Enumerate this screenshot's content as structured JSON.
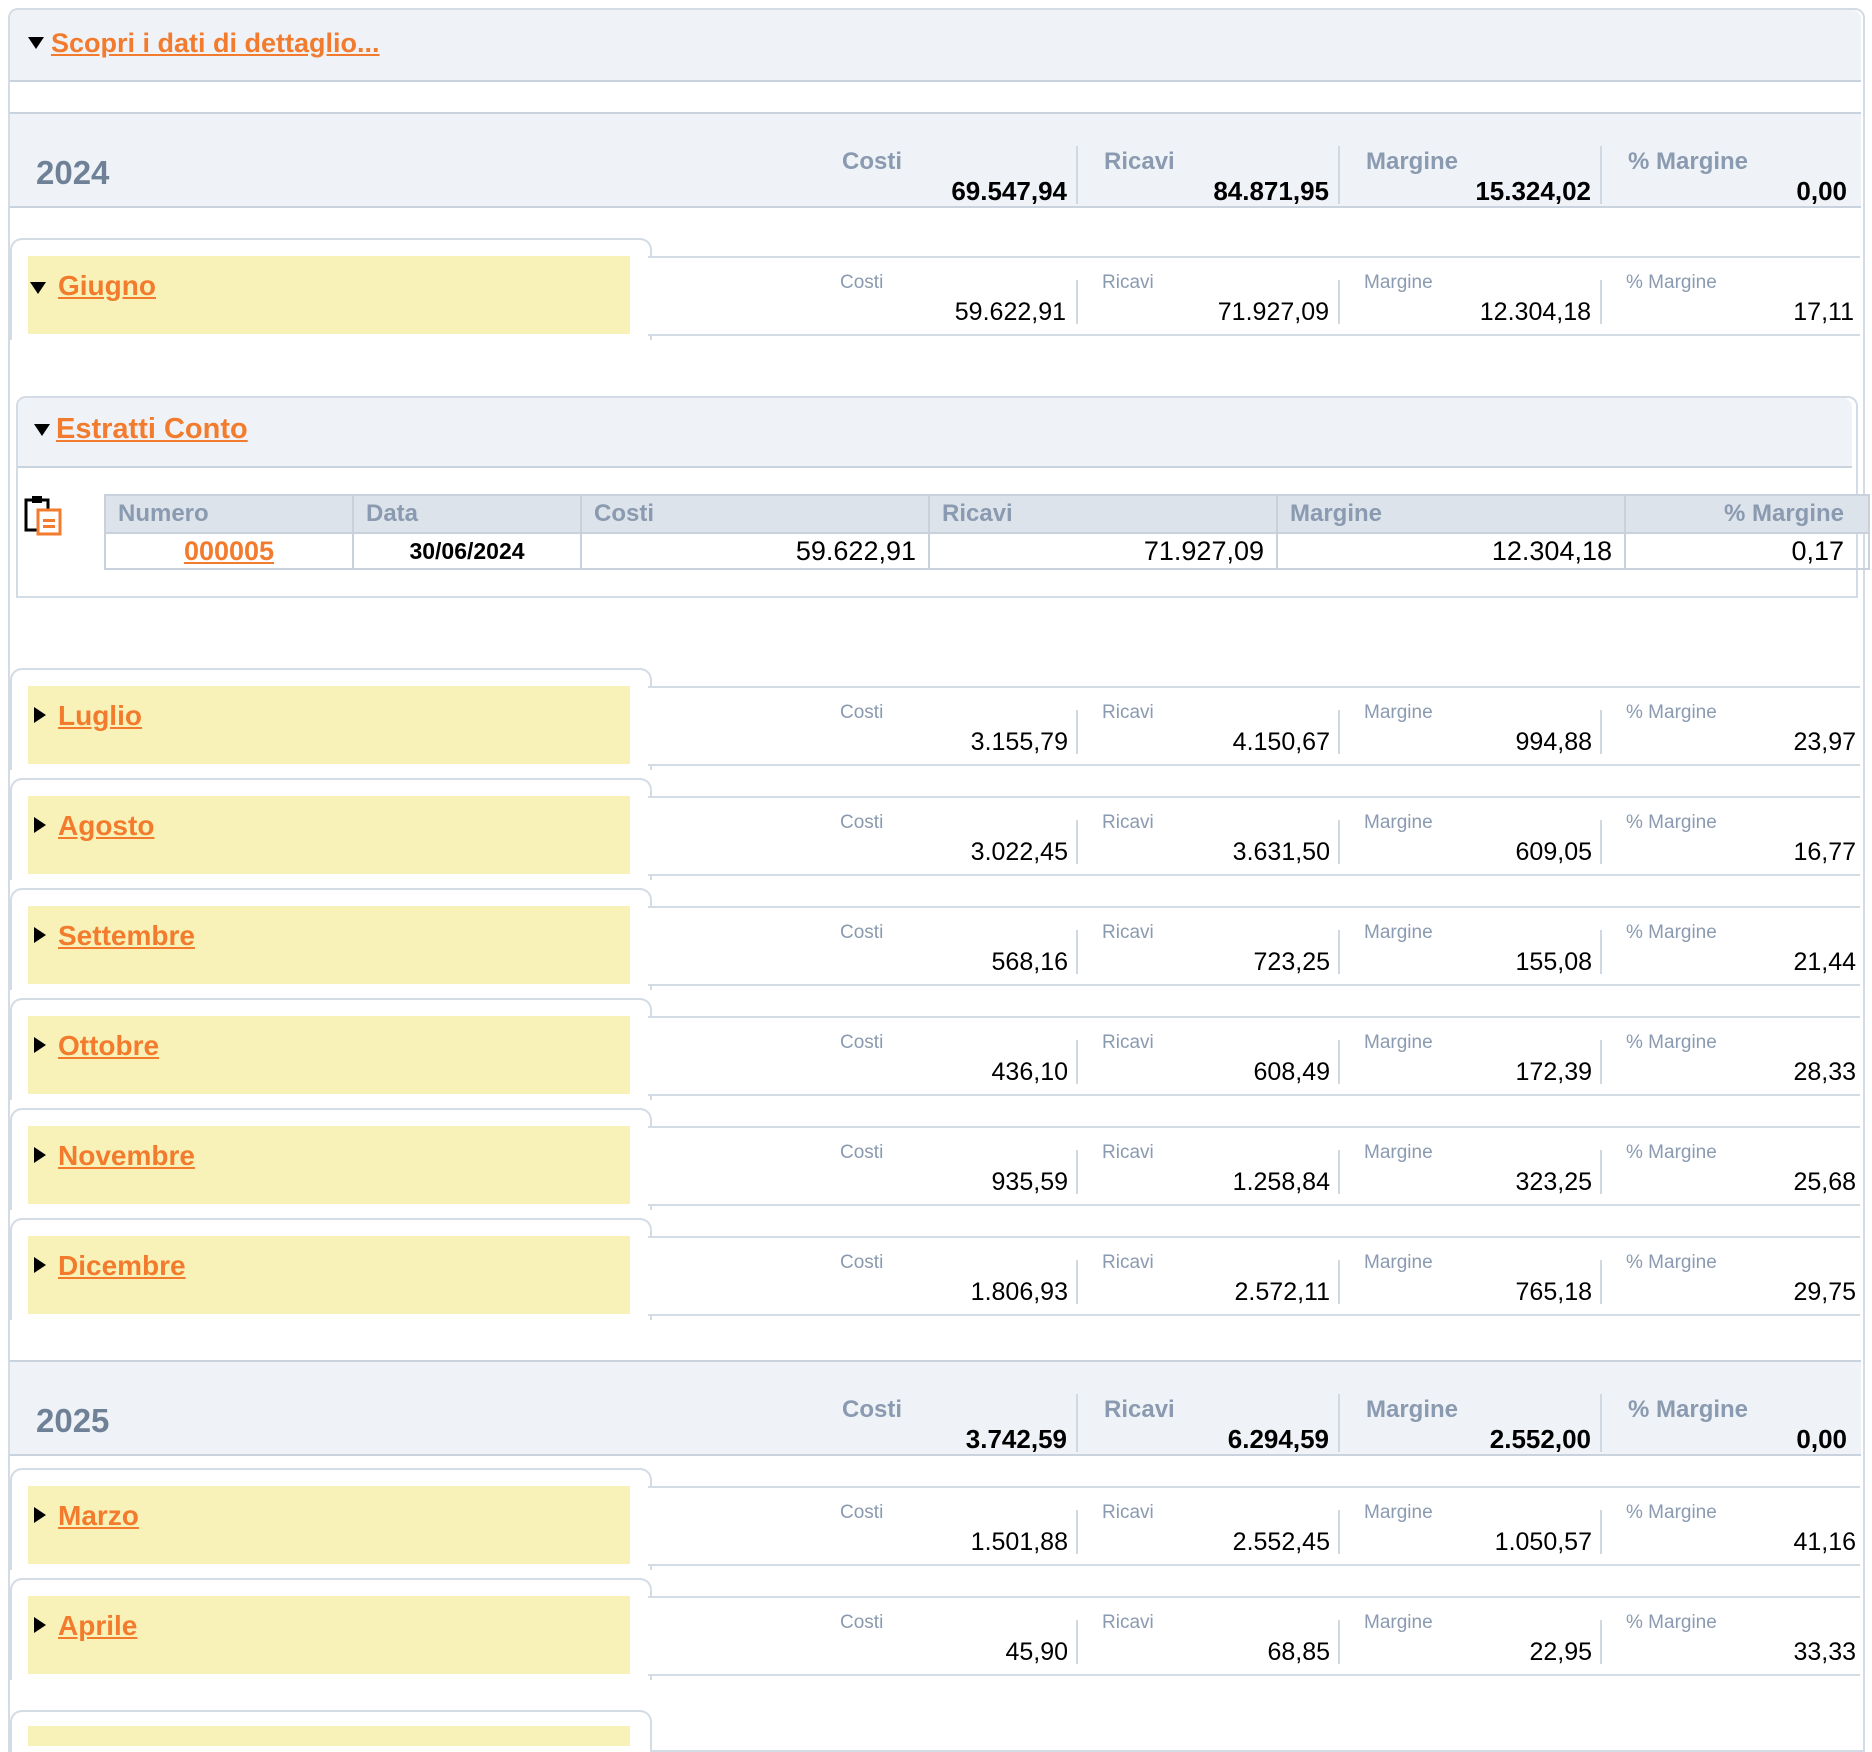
{
  "header": {
    "label": "Scopri i dati di dettaglio..."
  },
  "column_labels": {
    "costi": "Costi",
    "ricavi": "Ricavi",
    "margine": "Margine",
    "pct_margine": "% Margine"
  },
  "years": [
    {
      "year": "2024",
      "costi": "69.547,94",
      "ricavi": "84.871,95",
      "margine": "15.324,02",
      "pct": "0,00"
    },
    {
      "year": "2025",
      "costi": "3.742,59",
      "ricavi": "6.294,59",
      "margine": "2.552,00",
      "pct": "0,00"
    }
  ],
  "months": [
    {
      "name": "Giugno",
      "expanded": true,
      "costi": "59.622,91",
      "ricavi": "71.927,09",
      "margine": "12.304,18",
      "pct": "17,11"
    },
    {
      "name": "Luglio",
      "expanded": false,
      "costi": "3.155,79",
      "ricavi": "4.150,67",
      "margine": "994,88",
      "pct": "23,97"
    },
    {
      "name": "Agosto",
      "expanded": false,
      "costi": "3.022,45",
      "ricavi": "3.631,50",
      "margine": "609,05",
      "pct": "16,77"
    },
    {
      "name": "Settembre",
      "expanded": false,
      "costi": "568,16",
      "ricavi": "723,25",
      "margine": "155,08",
      "pct": "21,44"
    },
    {
      "name": "Ottobre",
      "expanded": false,
      "costi": "436,10",
      "ricavi": "608,49",
      "margine": "172,39",
      "pct": "28,33"
    },
    {
      "name": "Novembre",
      "expanded": false,
      "costi": "935,59",
      "ricavi": "1.258,84",
      "margine": "323,25",
      "pct": "25,68"
    },
    {
      "name": "Dicembre",
      "expanded": false,
      "costi": "1.806,93",
      "ricavi": "2.572,11",
      "margine": "765,18",
      "pct": "29,75"
    },
    {
      "name": "Marzo",
      "expanded": false,
      "costi": "1.501,88",
      "ricavi": "2.552,45",
      "margine": "1.050,57",
      "pct": "41,16"
    },
    {
      "name": "Aprile",
      "expanded": false,
      "costi": "45,90",
      "ricavi": "68,85",
      "margine": "22,95",
      "pct": "33,33"
    }
  ],
  "estratti": {
    "title": "Estratti Conto",
    "icon": "clipboard-icon",
    "headers": [
      "Numero",
      "Data",
      "Costi",
      "Ricavi",
      "Margine",
      "% Margine"
    ],
    "rows": [
      {
        "numero": "000005",
        "data": "30/06/2024",
        "costi": "59.622,91",
        "ricavi": "71.927,09",
        "margine": "12.304,18",
        "pct": "0,17"
      }
    ]
  },
  "colors": {
    "link": "#f27b2d",
    "month_fill": "#f8f2b8",
    "band": "#eff3f7",
    "label": "#8a9ab0"
  }
}
